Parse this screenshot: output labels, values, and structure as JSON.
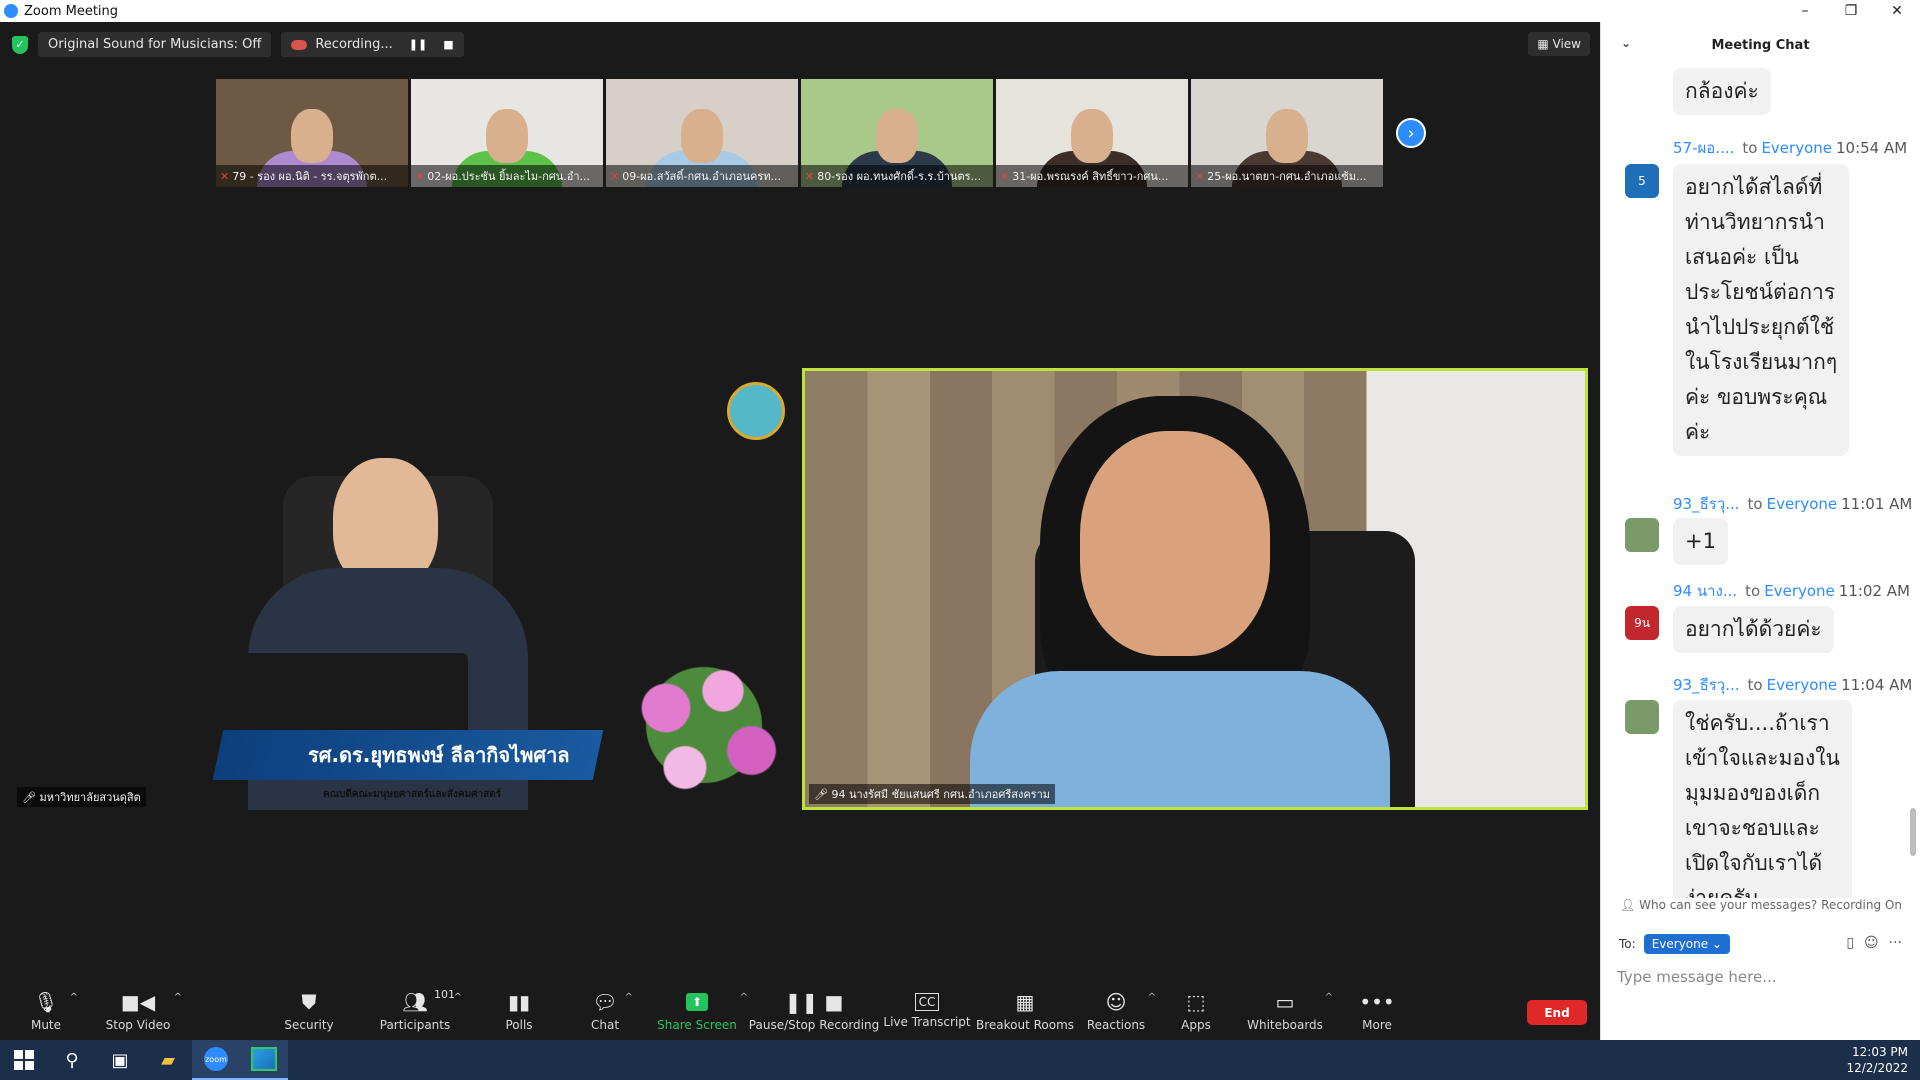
{
  "window": {
    "title": "Zoom Meeting",
    "minimize": "–",
    "restore": "❐",
    "close": "✕"
  },
  "top_bar": {
    "sound_badge": "Original Sound for Musicians: Off",
    "recording_label": "Recording...",
    "pause_glyph": "❚❚",
    "stop_glyph": "■",
    "view_label": "View"
  },
  "thumbnails": [
    {
      "label": "79 - รอง ผอ.นิติ - รร.จตุรพักต...",
      "bg": "#6e5a44",
      "shirt": "#b08ad0"
    },
    {
      "label": "02-ผอ.ประชัน ยิ้มละไม-กศน.อำ...",
      "bg": "#e8e6e2",
      "shirt": "#5cc24a"
    },
    {
      "label": "09-ผอ.สวัสดิ์-กศน.อำเภอนครท...",
      "bg": "#d6d0c8",
      "shirt": "#a7cbe6"
    },
    {
      "label": "80-รอง ผอ.ทนงศักดิ์-ร.ร.บ้านตร...",
      "bg": "#a9c98a",
      "shirt": "#2d3a4a"
    },
    {
      "label": "31-ผอ.พรณรงค์ สิทธิ์ขาว-กศน...",
      "bg": "#e6e3dd",
      "shirt": "#3b2f28"
    },
    {
      "label": "25-ผอ.นาตยา-กศน.อำเภอแซ้ม...",
      "bg": "#d9d6d2",
      "shirt": "#4a3a34"
    }
  ],
  "next_page_glyph": "›",
  "main_videos": {
    "left": {
      "banner_name": "รศ.ดร.ยุทธพงษ์ ลีลากิจไพศาล",
      "banner_sub": "คณบดีคณะมนุษยศาสตร์และสังคมศาสตร์",
      "tile_label": "มหาวิทยาลัยสวนดุสิต"
    },
    "right": {
      "tile_label": "94 นางรัศมี ชัยแสนศรี กศน.อำเภอศรีสงคราม"
    }
  },
  "toolbar": {
    "mute": "Mute",
    "stop_video": "Stop Video",
    "security": "Security",
    "participants": "Participants",
    "participants_count": "101",
    "polls": "Polls",
    "chat": "Chat",
    "share_screen": "Share Screen",
    "pause_stop_recording": "Pause/Stop Recording",
    "live_transcript": "Live Transcript",
    "breakout_rooms": "Breakout Rooms",
    "reactions": "Reactions",
    "apps": "Apps",
    "whiteboards": "Whiteboards",
    "more": "More",
    "end": "End",
    "caret": "^"
  },
  "chat": {
    "title": "Meeting Chat",
    "collapse_glyph": "⌄",
    "to_label": "to",
    "messages": [
      {
        "sender": "",
        "recipient": "",
        "time": "",
        "avatar": "",
        "avatar_color": "",
        "lines": [
          "กล้องค่ะ"
        ]
      },
      {
        "sender": "57-ผอ....",
        "recipient": "Everyone",
        "time": "10:54 AM",
        "avatar": "5",
        "avatar_color": "#1f6fb8",
        "lines": [
          "อยากได้สไลด์ที่",
          "ท่านวิทยากรนำ",
          "เสนอค่ะ เป็น",
          "ประโยชน์ต่อการ",
          "นำไปประยุกต์ใช้",
          "ในโรงเรียนมากๆ",
          "ค่ะ ขอบพระคุณ",
          "ค่ะ"
        ]
      },
      {
        "sender": "93_ธีรวุ...",
        "recipient": "Everyone",
        "time": "11:01 AM",
        "avatar": "",
        "avatar_color": "#7a9a6a",
        "lines": [
          "+1"
        ]
      },
      {
        "sender": "94 นาง...",
        "recipient": "Everyone",
        "time": "11:02 AM",
        "avatar": "9น",
        "avatar_color": "#c0282d",
        "lines": [
          "อยากได้ด้วยค่ะ"
        ]
      },
      {
        "sender": "93_ธีรวุ...",
        "recipient": "Everyone",
        "time": "11:04 AM",
        "avatar": "",
        "avatar_color": "#7a9a6a",
        "lines": [
          "ใช่ครับ....ถ้าเรา",
          "เข้าใจและมองใน",
          "มุมมองของเด็ก",
          "เขาจะชอบและ",
          "เปิดใจกับเราได้",
          "ง่ายครับ..."
        ]
      }
    ],
    "privacy_note": "Who can see your messages? Recording On",
    "to_prefix": "To:",
    "to_value": "Everyone ⌄",
    "input_placeholder": "Type message here...",
    "file_glyph": "▯",
    "emoji_glyph": "☺",
    "more_glyph": "···"
  },
  "taskbar": {
    "search_glyph": "⚲",
    "taskview_glyph": "▣",
    "explorer_glyph": "▰",
    "zoom_label": "zoom",
    "time": "12:03 PM",
    "date": "12/2/2022"
  }
}
